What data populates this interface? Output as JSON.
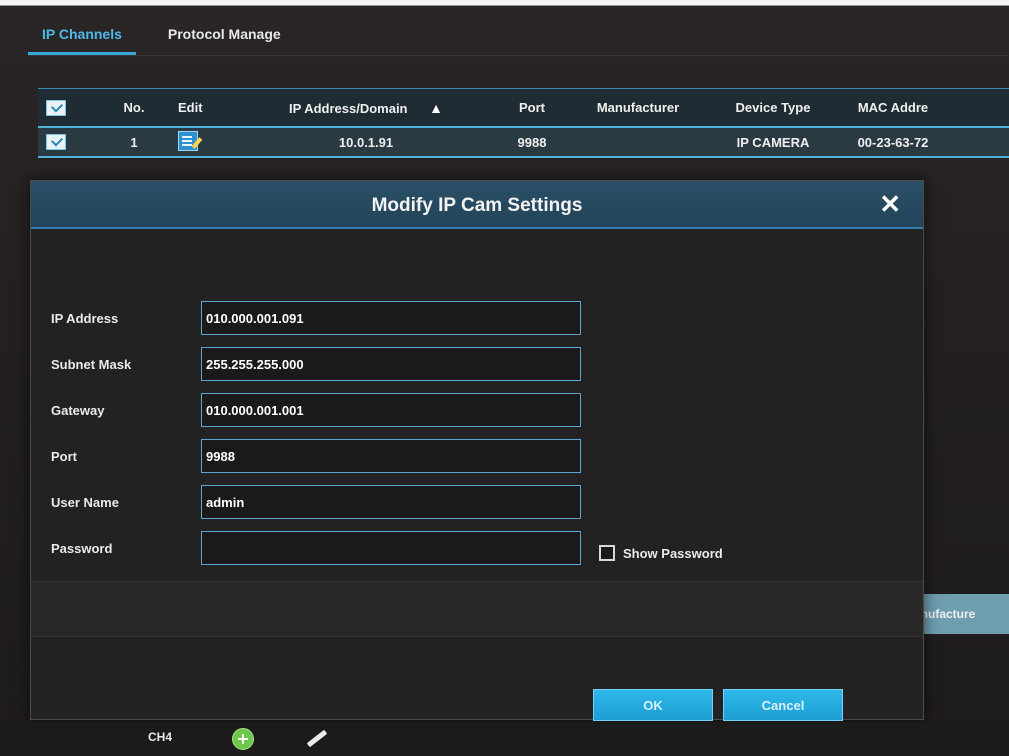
{
  "tabs": [
    {
      "label": "IP Channels",
      "active": true
    },
    {
      "label": "Protocol Manage",
      "active": false
    }
  ],
  "table": {
    "columns": {
      "no": "No.",
      "edit": "Edit",
      "ip": "IP Address/Domain",
      "port": "Port",
      "manufacturer": "Manufacturer",
      "device_type": "Device Type",
      "mac": "MAC Addre"
    },
    "rows": [
      {
        "no": "1",
        "ip": "10.0.1.91",
        "port": "9988",
        "manufacturer": "",
        "device_type": "IP CAMERA",
        "mac": "00-23-63-72"
      }
    ]
  },
  "dialog": {
    "title": "Modify IP Cam Settings",
    "close_symbol": "✕",
    "fields": {
      "ip_address": {
        "label": "IP Address",
        "value": "010.000.001.091"
      },
      "subnet_mask": {
        "label": "Subnet Mask",
        "value": "255.255.255.000"
      },
      "gateway": {
        "label": "Gateway",
        "value": "010.000.001.001"
      },
      "port": {
        "label": "Port",
        "value": "9988"
      },
      "user_name": {
        "label": "User Name",
        "value": "admin"
      },
      "password": {
        "label": "Password",
        "value": ""
      }
    },
    "show_password_label": "Show Password",
    "ok_label": "OK",
    "cancel_label": "Cancel"
  },
  "side_panel": {
    "label": "Manufacture"
  },
  "bottom_bar": {
    "channel_label": "CH4"
  },
  "sort_symbol": "^",
  "colors": {
    "accent": "#3aa6d8",
    "dialog_title_bar": "#2a4f66",
    "button": "#1d9ed2"
  },
  "icons": [
    "checkbox-icon",
    "edit-icon",
    "sort-up-icon",
    "close-icon",
    "add-icon",
    "pencil-icon"
  ]
}
